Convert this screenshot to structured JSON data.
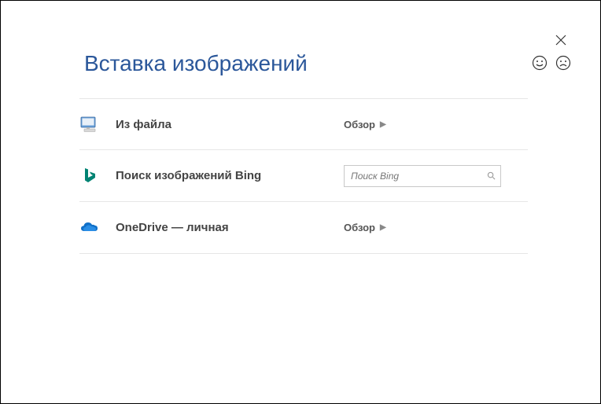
{
  "title": "Вставка изображений",
  "close_label": "Закрыть",
  "feedback": {
    "happy": "happy-face",
    "sad": "sad-face"
  },
  "rows": {
    "from_file": {
      "label": "Из файла",
      "action": "Обзор"
    },
    "bing": {
      "label": "Поиск изображений Bing",
      "placeholder": "Поиск Bing"
    },
    "onedrive": {
      "label": "OneDrive — личная",
      "action": "Обзор"
    }
  }
}
